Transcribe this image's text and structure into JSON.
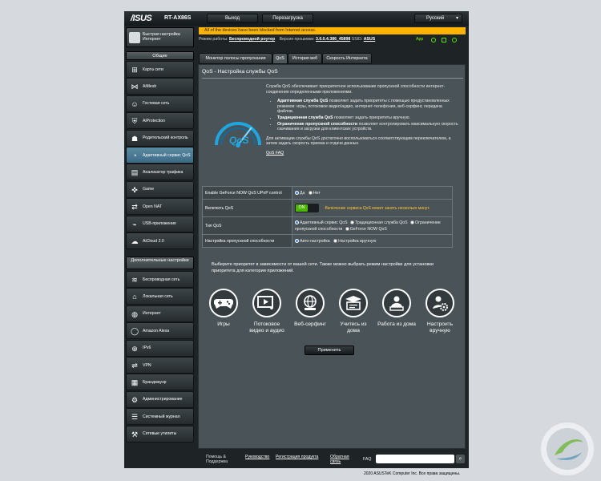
{
  "header": {
    "logo": "/ISUS",
    "model": "RT-AX86S",
    "logout": "Выход",
    "reboot": "Перезагрузка",
    "language": "Русский"
  },
  "notice": "All of the devices have been blocked from Internet access.",
  "status": {
    "mode_label": "Режим работы:",
    "mode_value": "Беспроводной роутер",
    "fw_label": "Версия прошивки:",
    "fw_value": "3.0.0.4.386_45898",
    "ssid_label": "SSID:",
    "ssid_value": "ASUS",
    "app": "App"
  },
  "sidebar": {
    "quick_setup": "Быстрая настройка Интернет",
    "section_general": "Общие",
    "general": [
      {
        "label": "Карта сети",
        "icon": "network-map-icon",
        "glyph": "⊞"
      },
      {
        "label": "AiMesh",
        "icon": "aimesh-icon",
        "glyph": "⋈"
      },
      {
        "label": "Гостевая сеть",
        "icon": "guest-network-icon",
        "glyph": "☺"
      },
      {
        "label": "AiProtection",
        "icon": "aiprotection-icon",
        "glyph": "⛨"
      },
      {
        "label": "Родительский контроль",
        "icon": "parental-control-icon",
        "glyph": "☗"
      },
      {
        "label": "Адаптивный сервис QoS",
        "icon": "adaptive-qos-icon",
        "glyph": "◔"
      },
      {
        "label": "Анализатор трафика",
        "icon": "traffic-analyzer-icon",
        "glyph": "▤"
      },
      {
        "label": "Game",
        "icon": "game-icon",
        "glyph": "✜"
      },
      {
        "label": "Open NAT",
        "icon": "open-nat-icon",
        "glyph": "⇄"
      },
      {
        "label": "USB-приложение",
        "icon": "usb-app-icon",
        "glyph": "⌁"
      },
      {
        "label": "AiCloud 2.0",
        "icon": "aicloud-icon",
        "glyph": "☁"
      }
    ],
    "section_advanced": "Дополнительные настройки",
    "advanced": [
      {
        "label": "Беспроводная сеть",
        "icon": "wireless-icon",
        "glyph": "≋"
      },
      {
        "label": "Локальная сеть",
        "icon": "lan-icon",
        "glyph": "⌂"
      },
      {
        "label": "Интернет",
        "icon": "internet-icon",
        "glyph": "◍"
      },
      {
        "label": "Amazon Alexa",
        "icon": "alexa-icon",
        "glyph": "◯"
      },
      {
        "label": "IPv6",
        "icon": "ipv6-icon",
        "glyph": "⊕"
      },
      {
        "label": "VPN",
        "icon": "vpn-icon",
        "glyph": "⇌"
      },
      {
        "label": "Брандмауэр",
        "icon": "firewall-icon",
        "glyph": "▦"
      },
      {
        "label": "Администрирование",
        "icon": "administration-icon",
        "glyph": "⚙"
      },
      {
        "label": "Системный журнал",
        "icon": "system-log-icon",
        "glyph": "☰"
      },
      {
        "label": "Сетевые утилиты",
        "icon": "network-tools-icon",
        "glyph": "⚒"
      }
    ]
  },
  "tabs": [
    {
      "label": "Монитор полосы пропускания"
    },
    {
      "label": "QoS"
    },
    {
      "label": "История веб"
    },
    {
      "label": "Скорость Интернета"
    }
  ],
  "panel": {
    "title": "QoS - Настройка службы QoS",
    "intro": "Служба QoS обеспечивает приоритетное использование пропускной способности интернет-соединения определенными приложениями.",
    "bullets": [
      {
        "name": "Адаптивная служба QoS",
        "text": "позволяет задать приоритеты с помощью предустановленных режимов: игры, потоковое видео/аудио, интернет-телефония, веб-серфинг, передача файлов."
      },
      {
        "name": "Традиционная служба QoS",
        "text": "позволяет задать приоритеты вручную."
      },
      {
        "name": "Ограничение пропускной способности",
        "text": "позволяет контролировать максимальную скорость скачивания и загрузки для клиентских устройств."
      }
    ],
    "activation": "Для активации службы QoS достаточно воспользоваться соответствующим переключателем, а затем задать скорость приема и отдачи данных.",
    "faq": "QoS FAQ",
    "gauge_text": "QoS"
  },
  "settings": {
    "row1_label": "Enable GeForce NOW QoS UPnP control",
    "yes": "Да",
    "no": "Нет",
    "row2_label": "Включить QoS",
    "toggle_on": "ON",
    "toggle_warning": "Включение сервиса QoS может занять несколько минут.",
    "row3_label": "Тип QoS",
    "type_adaptive": "Адаптивный сервис QoS",
    "type_traditional": "Традиционная служба QoS",
    "type_limiter": "Ограничение пропускной способности",
    "type_geforce": "GeForce NOW QoS",
    "row4_label": "Настройка пропускной способности",
    "bw_auto": "Авто-настройка",
    "bw_manual": "Настройка вручную"
  },
  "priority_text": "Выберите приоритет в зависимости от вашей сети. Также можно выбрать режим настройки для установки приоритета для категории приложений.",
  "priority": [
    {
      "label": "Игры",
      "icon": "gamepad-icon"
    },
    {
      "label": "Потоковое видео и аудио",
      "icon": "media-streaming-icon"
    },
    {
      "label": "Веб-серфинг",
      "icon": "web-surfing-icon"
    },
    {
      "label": "Учитесь из дома",
      "icon": "learn-from-home-icon"
    },
    {
      "label": "Работа из дома",
      "icon": "work-from-home-icon"
    },
    {
      "label": "Настроить вручную",
      "icon": "customize-icon"
    }
  ],
  "apply": "Применить",
  "footer": {
    "help": "Помощь & Поддержка",
    "manual": "Руководство",
    "registration": "Регистрация продукта",
    "feedback": "Обратная связь",
    "faq": "FAQ"
  },
  "copyright": "2020 ASUSTeK Computer Inc. Все права защищены."
}
